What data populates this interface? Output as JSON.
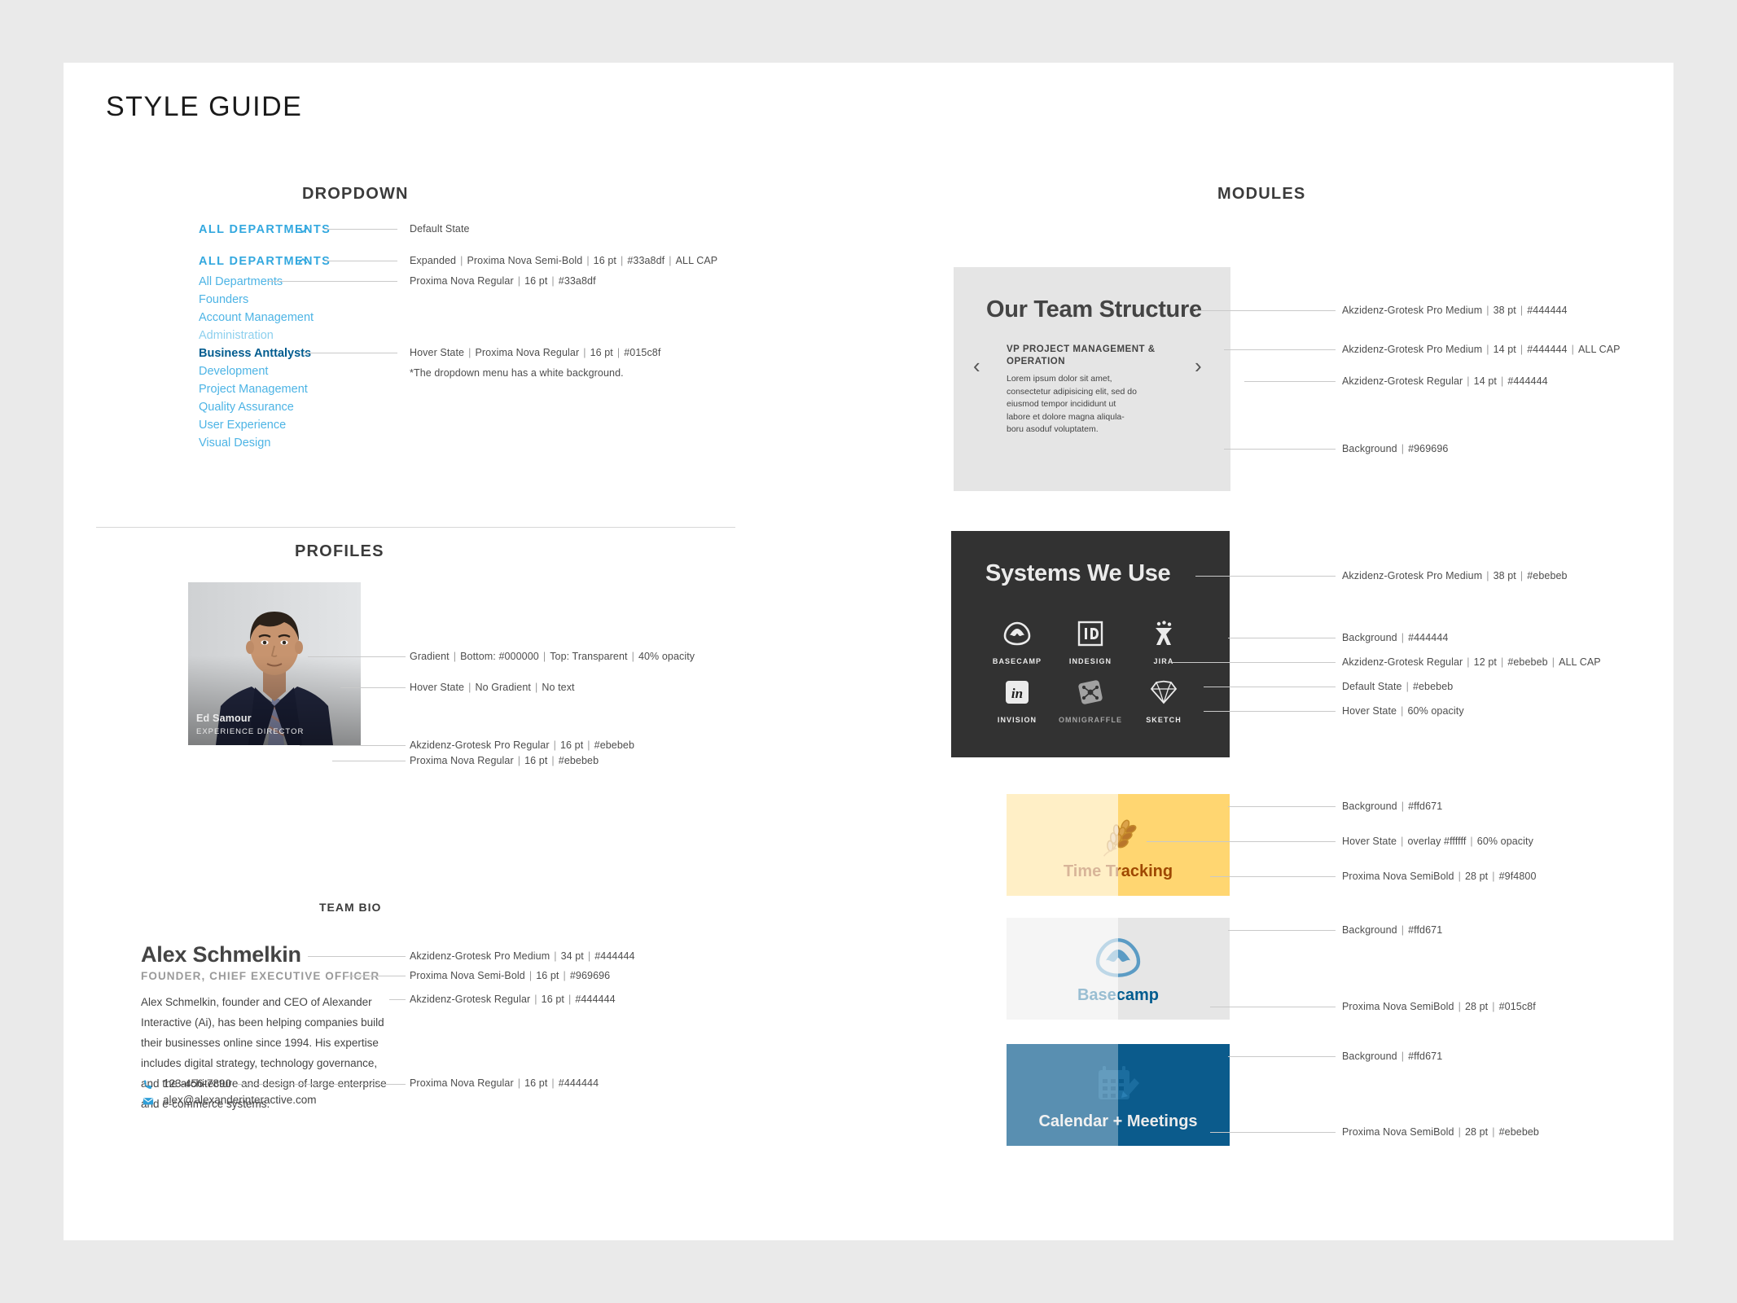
{
  "page": {
    "title": "STYLE GUIDE"
  },
  "sections": {
    "dropdown": "DROPDOWN",
    "profiles": "PROFILES",
    "team_bio": "TEAM BIO",
    "modules": "MODULES"
  },
  "dropdown": {
    "default_label": "ALL DEPARTMENTS",
    "expanded_label": "ALL DEPARTMENTS",
    "items": [
      "All Departments",
      "Founders",
      "Account Management",
      "Administration",
      "Business Anttalysts",
      "Development",
      "Project Management",
      "Quality Assurance",
      "User Experience",
      "Visual Design"
    ],
    "hover_item_index": 4,
    "annotations": {
      "default_state": "Default State",
      "expanded": "Expanded",
      "expanded_font": "Proxima Nova Semi-Bold",
      "expanded_size": "16 pt",
      "expanded_color": "#33a8df",
      "expanded_case": "ALL CAP",
      "item_font": "Proxima Nova Regular",
      "item_size": "16 pt",
      "item_color": "#33a8df",
      "hover_state": "Hover State",
      "hover_font": "Proxima Nova Regular",
      "hover_size": "16 pt",
      "hover_color": "#015c8f",
      "footnote": "*The dropdown menu has a white background."
    }
  },
  "profile": {
    "name": "Ed Samour",
    "role": "EXPERIENCE DIRECTOR",
    "annotations": {
      "gradient_label": "Gradient",
      "gradient_bottom": "Bottom: #000000",
      "gradient_top": "Top: Transparent",
      "gradient_opacity": "40% opacity",
      "hover_state": "Hover State",
      "hover_nograd": "No Gradient",
      "hover_notext": "No text",
      "name_font": "Akzidenz-Grotesk Pro Regular",
      "name_size": "16 pt",
      "name_color": "#ebebeb",
      "role_font": "Proxima Nova Regular",
      "role_size": "16 pt",
      "role_color": "#ebebeb"
    }
  },
  "bio": {
    "name": "Alex Schmelkin",
    "role": "FOUNDER, CHIEF EXECUTIVE OFFICER",
    "text": "Alex Schmelkin, founder and CEO of Alexander Interactive (Ai), has been helping companies build their businesses online since 1994. His expertise includes digital strategy, technology governance, and the architecture and design of large enterprise and e-commerce systems.",
    "phone": "123-456-7890",
    "email": "alex@alexanderinteractive.com",
    "annotations": {
      "name_font": "Akzidenz-Grotesk Pro Medium",
      "name_size": "34 pt",
      "name_color": "#444444",
      "role_font": "Proxima Nova Semi-Bold",
      "role_size": "16 pt",
      "role_color": "#969696",
      "body_font": "Akzidenz-Grotesk Regular",
      "body_size": "16 pt",
      "body_color": "#444444",
      "contact_font": "Proxima Nova Regular",
      "contact_size": "16 pt",
      "contact_color": "#444444"
    }
  },
  "module_team": {
    "heading": "Our Team Structure",
    "subheading": "VP PROJECT MANAGEMENT & OPERATION",
    "body": "Lorem ipsum dolor sit amet, consectetur adipisicing elit, sed do eiusmod tempor incididunt ut labore et dolore magna aliqula-boru asoduf voluptatem.",
    "prev_icon": "chevron-left",
    "next_icon": "chevron-right",
    "annotations": {
      "heading_font": "Akzidenz-Grotesk Pro Medium",
      "heading_size": "38 pt",
      "heading_color": "#444444",
      "sub_font": "Akzidenz-Grotesk Pro Medium",
      "sub_size": "14 pt",
      "sub_color": "#444444",
      "sub_case": "ALL CAP",
      "body_font": "Akzidenz-Grotesk Regular",
      "body_size": "14 pt",
      "body_color": "#444444",
      "bg_label": "Background",
      "bg_color": "#969696"
    }
  },
  "module_systems": {
    "heading": "Systems We Use",
    "items": [
      {
        "label": "BASECAMP",
        "icon": "basecamp-icon",
        "dimmed": false
      },
      {
        "label": "INDESIGN",
        "icon": "indesign-icon",
        "dimmed": false
      },
      {
        "label": "JIRA",
        "icon": "jira-icon",
        "dimmed": false
      },
      {
        "label": "INVISION",
        "icon": "invision-icon",
        "dimmed": false
      },
      {
        "label": "OMNIGRAFFLE",
        "icon": "omnigraffle-icon",
        "dimmed": true
      },
      {
        "label": "SKETCH",
        "icon": "sketch-icon",
        "dimmed": false
      }
    ],
    "annotations": {
      "heading_font": "Akzidenz-Grotesk Pro Medium",
      "heading_size": "38 pt",
      "heading_color": "#ebebeb",
      "bg_label": "Background",
      "bg_color": "#444444",
      "label_font": "Akzidenz-Grotesk Regular",
      "label_size": "12 pt",
      "label_color": "#ebebeb",
      "label_case": "ALL CAP",
      "default_state": "Default State",
      "default_color": "#ebebeb",
      "hover_state": "Hover State",
      "hover_value": "60% opacity"
    }
  },
  "tiles": [
    {
      "caption": "Time Tracking",
      "icon": "wheat-icon",
      "bg": "#ffd671",
      "text_color": "#9f4800",
      "annotations": {
        "bg_label": "Background",
        "bg_value": "#ffd671",
        "hover_label": "Hover State",
        "hover_overlay": "overlay #ffffff",
        "hover_opacity": "60% opacity",
        "font": "Proxima Nova SemiBold",
        "size": "28 pt",
        "color": "#9f4800"
      }
    },
    {
      "caption": "Basecamp",
      "icon": "basecamp-icon",
      "bg": "#e6e6e6",
      "text_color": "#015c8f",
      "annotations": {
        "bg_label": "Background",
        "bg_value": "#ffd671",
        "font": "Proxima Nova SemiBold",
        "size": "28 pt",
        "color": "#015c8f"
      }
    },
    {
      "caption": "Calendar + Meetings",
      "icon": "calendar-edit-icon",
      "bg": "#0b5b8c",
      "text_color": "#ebebeb",
      "annotations": {
        "bg_label": "Background",
        "bg_value": "#ffd671",
        "font": "Proxima Nova SemiBold",
        "size": "28 pt",
        "color": "#ebebeb"
      }
    }
  ]
}
